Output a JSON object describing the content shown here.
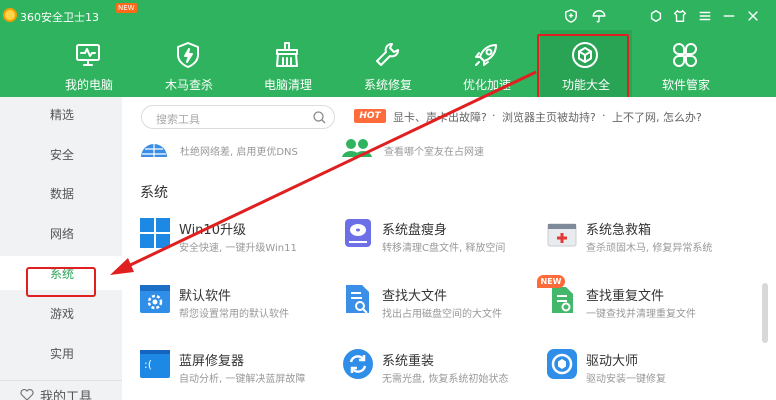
{
  "titlebar": {
    "app_title": "360安全卫士13",
    "new_badge": "NEW"
  },
  "nav": [
    {
      "label": "我的电脑",
      "icon": "monitor-icon"
    },
    {
      "label": "木马查杀",
      "icon": "shield-bolt-icon"
    },
    {
      "label": "电脑清理",
      "icon": "broom-icon"
    },
    {
      "label": "系统修复",
      "icon": "wrench-icon"
    },
    {
      "label": "优化加速",
      "icon": "rocket-icon"
    },
    {
      "label": "功能大全",
      "icon": "cube-icon",
      "active": true
    },
    {
      "label": "软件管家",
      "icon": "grid-icon"
    }
  ],
  "sidebar": {
    "items": [
      "精选",
      "安全",
      "数据",
      "网络",
      "系统",
      "游戏",
      "实用"
    ],
    "active": "系统",
    "tools_label": "我的工具"
  },
  "search": {
    "placeholder": "搜索工具",
    "hot_label": "HOT",
    "hot_links": [
      "显卡、声卡出故障?",
      "浏览器主页被劫持?",
      "上不了网, 怎么办?"
    ],
    "separator": "·"
  },
  "partial_row": [
    {
      "desc": "杜绝网络差, 启用更优DNS"
    },
    {
      "desc": "查看哪个室友在占网速"
    }
  ],
  "section": {
    "title": "系统"
  },
  "tools": [
    {
      "title": "Win10升级",
      "desc": "安全快速, 一键升级Win11",
      "icon": "windows-icon"
    },
    {
      "title": "系统盘瘦身",
      "desc": "转移清理C盘文件, 释放空间",
      "icon": "disk-icon"
    },
    {
      "title": "系统急救箱",
      "desc": "查杀顽固木马, 修复异常系统",
      "icon": "first-aid-icon"
    },
    {
      "title": "默认软件",
      "desc": "帮您设置常用的默认软件",
      "icon": "settings-window-icon"
    },
    {
      "title": "查找大文件",
      "desc": "找出占用磁盘空间的大文件",
      "icon": "file-search-icon"
    },
    {
      "title": "查找重复文件",
      "desc": "一键查找并清理重复文件",
      "icon": "duplicate-file-icon",
      "badge": "NEW"
    },
    {
      "title": "蓝屏修复器",
      "desc": "自动分析, 一键解决蓝屏故障",
      "icon": "bluescreen-icon"
    },
    {
      "title": "系统重装",
      "desc": "无需光盘, 恢复系统初始状态",
      "icon": "reinstall-icon"
    },
    {
      "title": "驱动大师",
      "desc": "驱动安装一键修复",
      "icon": "driver-icon"
    }
  ],
  "colors": {
    "header_green": "#2fb35e",
    "accent_green": "#2ea45a",
    "annotation_red": "#e02020"
  }
}
